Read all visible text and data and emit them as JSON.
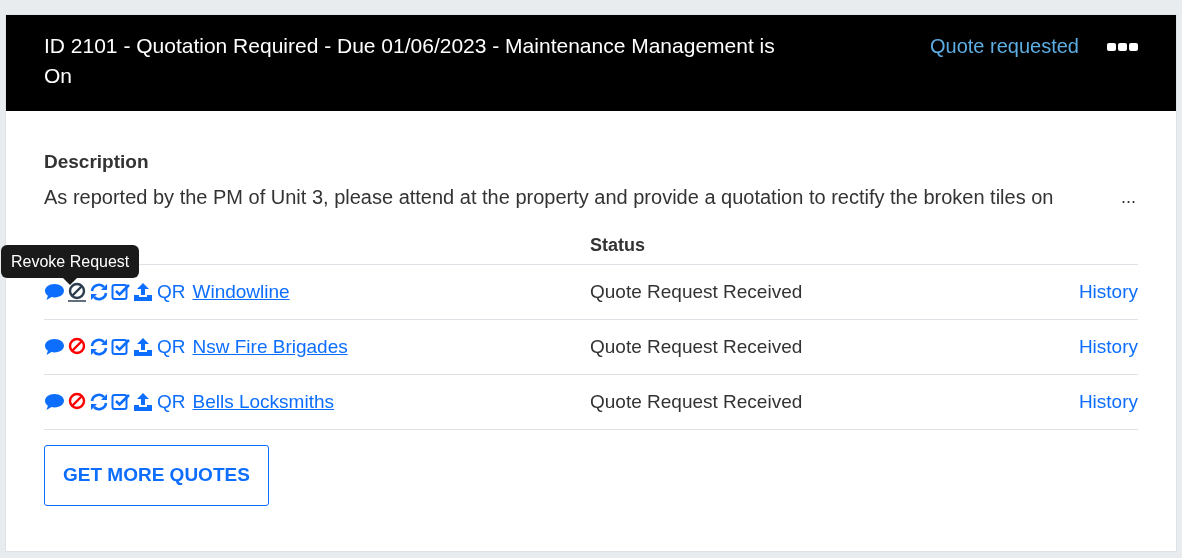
{
  "header": {
    "title": "ID 2101 - Quotation Required - Due 01/06/2023 - Maintenance Management is On",
    "status": "Quote requested"
  },
  "description": {
    "label": "Description",
    "text": "As reported by the PM of Unit 3, please attend at the property and provide a quotation to rectify the broken tiles on",
    "more": "..."
  },
  "table": {
    "columns": [
      "Status"
    ],
    "rows": [
      {
        "revoke_hovered": true,
        "prefix": "QR",
        "contractor": "Windowline",
        "status": "Quote Request Received",
        "link": "History"
      },
      {
        "revoke_hovered": false,
        "prefix": "QR",
        "contractor": "Nsw Fire Brigades",
        "status": "Quote Request Received",
        "link": "History"
      },
      {
        "revoke_hovered": false,
        "prefix": "QR",
        "contractor": "Bells Locksmiths",
        "status": "Quote Request Received",
        "link": "History"
      }
    ]
  },
  "tooltip": "Revoke Request",
  "button": "GET MORE QUOTES"
}
